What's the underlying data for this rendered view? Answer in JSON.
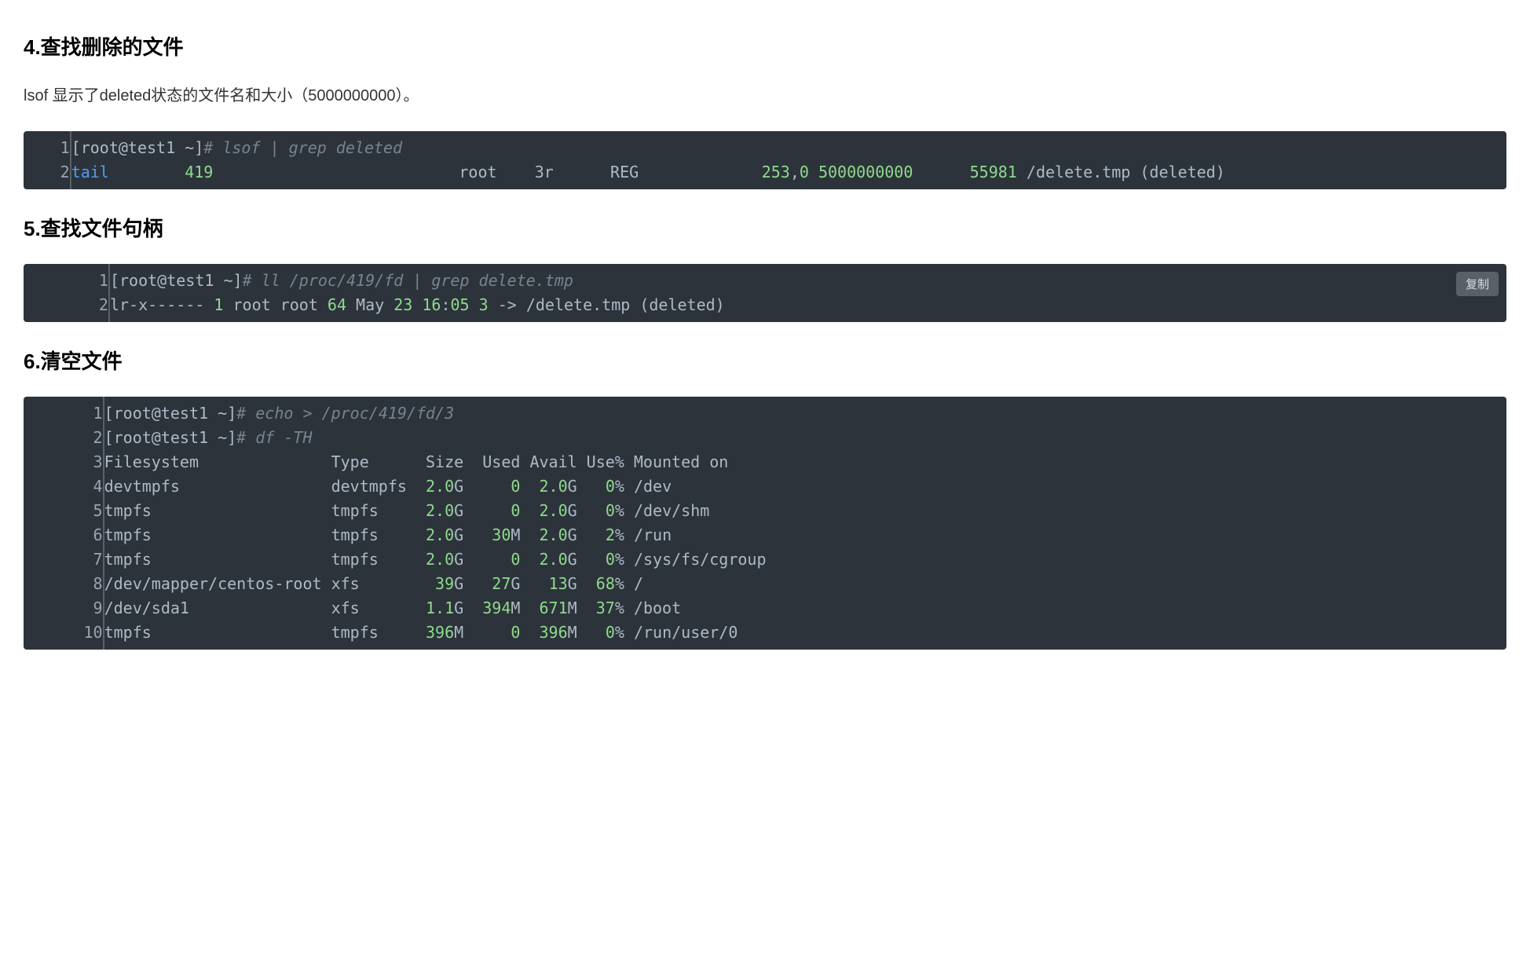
{
  "sections": {
    "s4": {
      "heading": "4.查找删除的文件",
      "paragraph": "lsof 显示了deleted状态的文件名和大小（5000000000）。"
    },
    "s5": {
      "heading": "5.查找文件句柄"
    },
    "s6": {
      "heading": "6.清空文件"
    }
  },
  "copy_label": "复制",
  "code_blocks": {
    "block1": {
      "lines": [
        {
          "num": "1",
          "tokens": [
            {
              "t": "[root@test1 ~]",
              "c": "c-prompt"
            },
            {
              "t": "# lsof | grep deleted",
              "c": "c-comment"
            }
          ]
        },
        {
          "num": "2",
          "tokens": [
            {
              "t": "tail",
              "c": "c-blue"
            },
            {
              "t": "        ",
              "c": "c-default"
            },
            {
              "t": "419",
              "c": "c-green"
            },
            {
              "t": "                          root    3r      REG             ",
              "c": "c-default"
            },
            {
              "t": "253",
              "c": "c-green"
            },
            {
              "t": ",",
              "c": "c-default"
            },
            {
              "t": "0",
              "c": "c-green"
            },
            {
              "t": " ",
              "c": "c-default"
            },
            {
              "t": "5000000000",
              "c": "c-green"
            },
            {
              "t": "      ",
              "c": "c-default"
            },
            {
              "t": "55981",
              "c": "c-green"
            },
            {
              "t": " /delete.tmp (deleted)",
              "c": "c-default"
            }
          ]
        }
      ]
    },
    "block2": {
      "lines": [
        {
          "num": "1",
          "tokens": [
            {
              "t": "[root@test1 ~]",
              "c": "c-prompt"
            },
            {
              "t": "# ll /proc/419/fd | grep delete.tmp",
              "c": "c-comment"
            }
          ]
        },
        {
          "num": "2",
          "tokens": [
            {
              "t": "lr-x------ ",
              "c": "c-default"
            },
            {
              "t": "1",
              "c": "c-green"
            },
            {
              "t": " root root ",
              "c": "c-default"
            },
            {
              "t": "64",
              "c": "c-green"
            },
            {
              "t": " May ",
              "c": "c-default"
            },
            {
              "t": "23",
              "c": "c-green"
            },
            {
              "t": " ",
              "c": "c-default"
            },
            {
              "t": "16",
              "c": "c-green"
            },
            {
              "t": ":",
              "c": "c-default"
            },
            {
              "t": "05",
              "c": "c-green"
            },
            {
              "t": " ",
              "c": "c-default"
            },
            {
              "t": "3",
              "c": "c-green"
            },
            {
              "t": " -> /delete.tmp (deleted)",
              "c": "c-default"
            }
          ]
        }
      ]
    },
    "block3": {
      "lines": [
        {
          "num": "1",
          "tokens": [
            {
              "t": "[root@test1 ~]",
              "c": "c-prompt"
            },
            {
              "t": "# echo > /proc/419/fd/3",
              "c": "c-comment"
            }
          ]
        },
        {
          "num": "2",
          "tokens": [
            {
              "t": "[root@test1 ~]",
              "c": "c-prompt"
            },
            {
              "t": "# df -TH",
              "c": "c-comment"
            }
          ]
        },
        {
          "num": "3",
          "tokens": [
            {
              "t": "Filesystem              Type      Size  Used Avail Use% Mounted on",
              "c": "c-default"
            }
          ]
        },
        {
          "num": "4",
          "tokens": [
            {
              "t": "devtmpfs                devtmpfs  ",
              "c": "c-default"
            },
            {
              "t": "2.0",
              "c": "c-green"
            },
            {
              "t": "G     ",
              "c": "c-default"
            },
            {
              "t": "0",
              "c": "c-green"
            },
            {
              "t": "  ",
              "c": "c-default"
            },
            {
              "t": "2.0",
              "c": "c-green"
            },
            {
              "t": "G   ",
              "c": "c-default"
            },
            {
              "t": "0",
              "c": "c-green"
            },
            {
              "t": "% /dev",
              "c": "c-default"
            }
          ]
        },
        {
          "num": "5",
          "tokens": [
            {
              "t": "tmpfs                   tmpfs     ",
              "c": "c-default"
            },
            {
              "t": "2.0",
              "c": "c-green"
            },
            {
              "t": "G     ",
              "c": "c-default"
            },
            {
              "t": "0",
              "c": "c-green"
            },
            {
              "t": "  ",
              "c": "c-default"
            },
            {
              "t": "2.0",
              "c": "c-green"
            },
            {
              "t": "G   ",
              "c": "c-default"
            },
            {
              "t": "0",
              "c": "c-green"
            },
            {
              "t": "% /dev/shm",
              "c": "c-default"
            }
          ]
        },
        {
          "num": "6",
          "tokens": [
            {
              "t": "tmpfs                   tmpfs     ",
              "c": "c-default"
            },
            {
              "t": "2.0",
              "c": "c-green"
            },
            {
              "t": "G   ",
              "c": "c-default"
            },
            {
              "t": "30",
              "c": "c-green"
            },
            {
              "t": "M  ",
              "c": "c-default"
            },
            {
              "t": "2.0",
              "c": "c-green"
            },
            {
              "t": "G   ",
              "c": "c-default"
            },
            {
              "t": "2",
              "c": "c-green"
            },
            {
              "t": "% /run",
              "c": "c-default"
            }
          ]
        },
        {
          "num": "7",
          "tokens": [
            {
              "t": "tmpfs                   tmpfs     ",
              "c": "c-default"
            },
            {
              "t": "2.0",
              "c": "c-green"
            },
            {
              "t": "G     ",
              "c": "c-default"
            },
            {
              "t": "0",
              "c": "c-green"
            },
            {
              "t": "  ",
              "c": "c-default"
            },
            {
              "t": "2.0",
              "c": "c-green"
            },
            {
              "t": "G   ",
              "c": "c-default"
            },
            {
              "t": "0",
              "c": "c-green"
            },
            {
              "t": "% /sys/fs/cgroup",
              "c": "c-default"
            }
          ]
        },
        {
          "num": "8",
          "tokens": [
            {
              "t": "/dev/mapper/centos-root xfs        ",
              "c": "c-default"
            },
            {
              "t": "39",
              "c": "c-green"
            },
            {
              "t": "G   ",
              "c": "c-default"
            },
            {
              "t": "27",
              "c": "c-green"
            },
            {
              "t": "G   ",
              "c": "c-default"
            },
            {
              "t": "13",
              "c": "c-green"
            },
            {
              "t": "G  ",
              "c": "c-default"
            },
            {
              "t": "68",
              "c": "c-green"
            },
            {
              "t": "% /",
              "c": "c-default"
            }
          ]
        },
        {
          "num": "9",
          "tokens": [
            {
              "t": "/dev/sda1               xfs       ",
              "c": "c-default"
            },
            {
              "t": "1.1",
              "c": "c-green"
            },
            {
              "t": "G  ",
              "c": "c-default"
            },
            {
              "t": "394",
              "c": "c-green"
            },
            {
              "t": "M  ",
              "c": "c-default"
            },
            {
              "t": "671",
              "c": "c-green"
            },
            {
              "t": "M  ",
              "c": "c-default"
            },
            {
              "t": "37",
              "c": "c-green"
            },
            {
              "t": "% /boot",
              "c": "c-default"
            }
          ]
        },
        {
          "num": "10",
          "tokens": [
            {
              "t": "tmpfs                   tmpfs     ",
              "c": "c-default"
            },
            {
              "t": "396",
              "c": "c-green"
            },
            {
              "t": "M     ",
              "c": "c-default"
            },
            {
              "t": "0",
              "c": "c-green"
            },
            {
              "t": "  ",
              "c": "c-default"
            },
            {
              "t": "396",
              "c": "c-green"
            },
            {
              "t": "M   ",
              "c": "c-default"
            },
            {
              "t": "0",
              "c": "c-green"
            },
            {
              "t": "% /run/user/0",
              "c": "c-default"
            }
          ]
        }
      ]
    }
  }
}
